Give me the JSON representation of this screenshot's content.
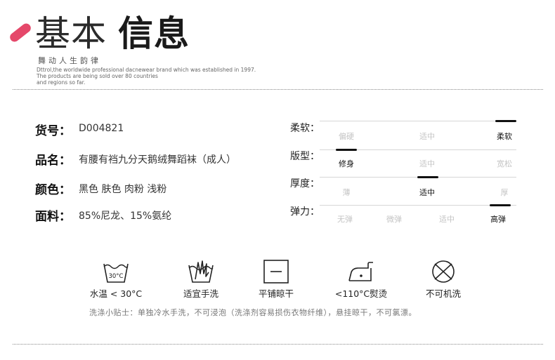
{
  "header": {
    "title_light": "基本",
    "title_bold": "信息",
    "subtitle": "舞动人生韵律",
    "brand_line1": "Dttrol,the worldwide professional dacnewear brand which was established in 1997.",
    "brand_line2": "The products are being sold over 80 countries",
    "brand_line3": "and regions so far."
  },
  "info": [
    {
      "label": "货号：",
      "value": "D004821"
    },
    {
      "label": "品名：",
      "value": "有腰有裆九分天鹅绒舞蹈袜（成人）"
    },
    {
      "label": "颜色：",
      "value": "黑色  肤色  肉粉  浅粉"
    },
    {
      "label": "面料：",
      "value": "85%尼龙、15%氨纶"
    }
  ],
  "scales": [
    {
      "label": "柔软：",
      "options": [
        "偏硬",
        "适中",
        "柔软"
      ],
      "selected": 2
    },
    {
      "label": "版型：",
      "options": [
        "修身",
        "适中",
        "宽松"
      ],
      "selected": 0
    },
    {
      "label": "厚度：",
      "options": [
        "薄",
        "适中",
        "厚"
      ],
      "selected": 1
    },
    {
      "label": "弹力：",
      "options": [
        "无弹",
        "微弹",
        "适中",
        "高弹"
      ],
      "selected": 3
    }
  ],
  "care": {
    "wash_temp_icon_text": "30°C",
    "items": [
      {
        "icon": "wash-basin-icon",
        "label": "水温 < 30°C"
      },
      {
        "icon": "hand-wash-icon",
        "label": "适宜手洗"
      },
      {
        "icon": "flat-dry-icon",
        "label": "平铺晾干"
      },
      {
        "icon": "iron-icon",
        "label": "<110°C熨烫"
      },
      {
        "icon": "no-machine-wash-icon",
        "label": "不可机洗"
      }
    ],
    "tip": "洗涤小贴士：单独冷水手洗，不可浸泡（洗涤剂容易损伤衣物纤维），悬挂晾干，不可氯漂。"
  },
  "colors": {
    "accent": "#e5486a",
    "text": "#222222",
    "muted": "#c4c4c4"
  }
}
